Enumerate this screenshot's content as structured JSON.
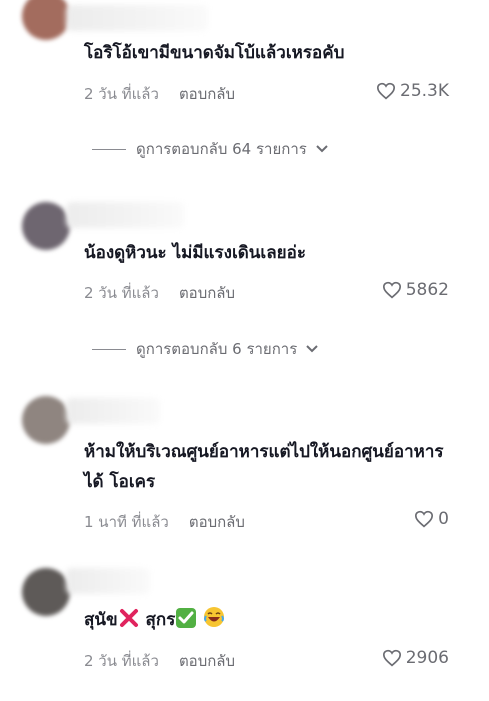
{
  "comments": [
    {
      "text": "โอริโอ้เขามีขนาดจัมโบ้แล้วเหรอคับ",
      "time": "2 วัน ที่แล้ว",
      "reply_label": "ตอบกลับ",
      "likes": "25.3K",
      "avatar_color": "#a36c5e",
      "view_replies": "ดูการตอบกลับ 64 รายการ"
    },
    {
      "text": "น้องดูหิวนะ ไม่มีแรงเดินเลยอ่ะ",
      "time": "2 วัน ที่แล้ว",
      "reply_label": "ตอบกลับ",
      "likes": "5862",
      "avatar_color": "#6e6670",
      "view_replies": "ดูการตอบกลับ 6 รายการ"
    },
    {
      "text": "ห้ามให้บริเวณศูนย์อาหารแต่ไปให้นอกศูนย์อาหารได้ โอเคร",
      "time": "1 นาที ที่แล้ว",
      "reply_label": "ตอบกลับ",
      "likes": "0",
      "avatar_color": "#8f8580"
    },
    {
      "text_before": "สุนัข",
      "text_mid": " สุกร",
      "time": "2 วัน ที่แล้ว",
      "reply_label": "ตอบกลับ",
      "likes": "2906",
      "avatar_color": "#5e5a58",
      "emojis": [
        "cross-mark-icon",
        "check-mark-icon",
        "laughing-face-icon"
      ]
    }
  ]
}
